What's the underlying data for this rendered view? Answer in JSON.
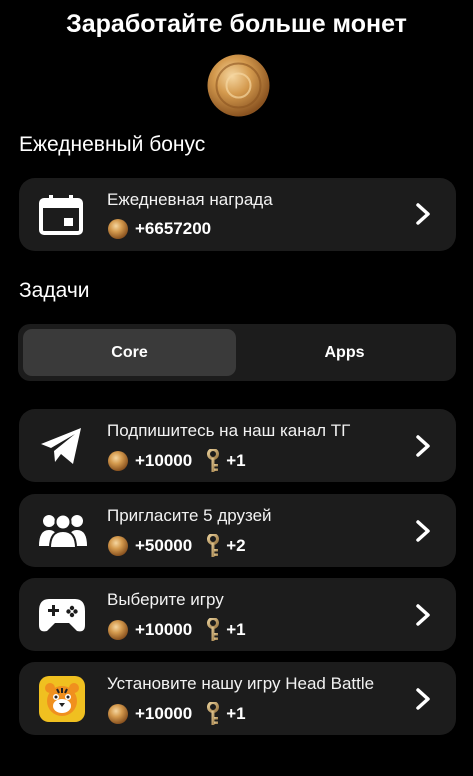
{
  "header": {
    "title": "Заработайте больше монет"
  },
  "daily": {
    "section_title": "Ежедневный бонус",
    "card": {
      "label": "Ежедневная награда",
      "reward": "+6657200",
      "icon": "calendar-icon"
    }
  },
  "tasks": {
    "section_title": "Задачи",
    "tabs": [
      {
        "label": "Core",
        "active": true
      },
      {
        "label": "Apps",
        "active": false
      }
    ],
    "items": [
      {
        "label": "Подпишитесь на наш канал ТГ",
        "coins": "+10000",
        "keys": "+1",
        "icon": "telegram-icon"
      },
      {
        "label": "Пригласите 5 друзей",
        "coins": "+50000",
        "keys": "+2",
        "icon": "users-icon"
      },
      {
        "label": "Выберите игру",
        "coins": "+10000",
        "keys": "+1",
        "icon": "gamepad-icon"
      },
      {
        "label": "Установите нашу игру Head Battle",
        "coins": "+10000",
        "keys": "+1",
        "icon": "tiger-app-icon"
      }
    ]
  },
  "colors": {
    "background": "#000000",
    "card": "#1c1c1c",
    "active_tab": "#3a3a3a",
    "coin": "#c98a3a",
    "key": "#c9a46a"
  }
}
